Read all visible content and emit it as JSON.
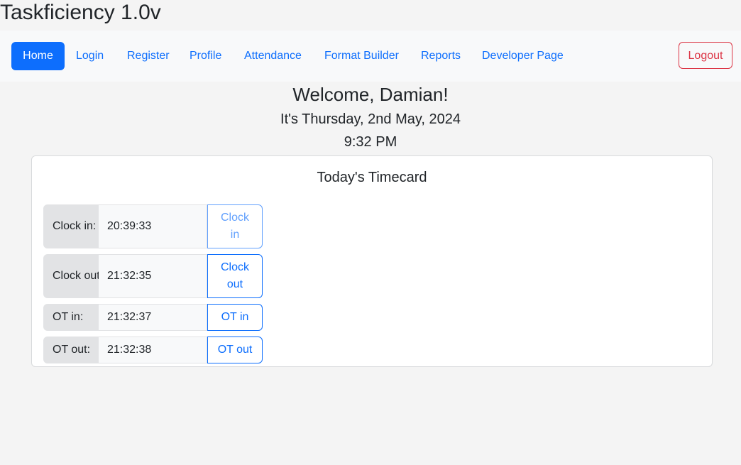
{
  "app": {
    "title": "Taskficiency 1.0v"
  },
  "nav": {
    "items": [
      {
        "label": "Home",
        "active": true
      },
      {
        "label": "Login"
      },
      {
        "label": "Register"
      },
      {
        "label": "Profile"
      },
      {
        "label": "Attendance"
      },
      {
        "label": "Format Builder"
      },
      {
        "label": "Reports"
      },
      {
        "label": "Developer Page"
      }
    ],
    "logout_label": "Logout"
  },
  "greeting": {
    "welcome": "Welcome, Damian!",
    "date": "It's Thursday, 2nd May, 2024",
    "time": "9:32 PM"
  },
  "timecard": {
    "title": "Today's Timecard",
    "rows": [
      {
        "label": "Clock in:",
        "value": "20:39:33",
        "button": "Clock in",
        "disabled": true
      },
      {
        "label": "Clock out:",
        "value": "21:32:35",
        "button": "Clock out",
        "disabled": false
      },
      {
        "label": "OT in:",
        "value": "21:32:37",
        "button": "OT in",
        "disabled": false
      },
      {
        "label": "OT out:",
        "value": "21:32:38",
        "button": "OT out",
        "disabled": false
      }
    ]
  },
  "colors": {
    "primary": "#0d6efd",
    "danger": "#dc3545",
    "page_background": "#f4f4f4",
    "navbar_background": "#f8f9fa"
  }
}
